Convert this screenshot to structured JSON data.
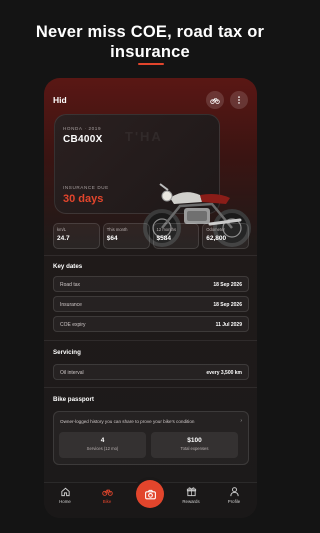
{
  "headline": {
    "line1": "Never miss COE, road tax or",
    "line2": "insurance"
  },
  "app": {
    "user_name": "Hid",
    "hero": {
      "make": "HONDA",
      "year": "2019",
      "model": "CB400X",
      "watermark": "T'HA",
      "insurance_label": "INSURANCE DUE",
      "insurance_value": "30 days"
    },
    "stats": [
      {
        "label": "km/L",
        "value": "24.7"
      },
      {
        "label": "This month",
        "value": "$64"
      },
      {
        "label": "12 months",
        "value": "$584"
      },
      {
        "label": "Odometer",
        "value": "62,800"
      }
    ],
    "key_dates": {
      "title": "Key dates",
      "items": [
        {
          "label": "Road tax",
          "value": "18 Sep 2026"
        },
        {
          "label": "Insurance",
          "value": "18 Sep 2026"
        },
        {
          "label": "COE expiry",
          "value": "11 Jul 2029"
        }
      ]
    },
    "servicing": {
      "title": "Servicing",
      "item": {
        "label": "Oil interval",
        "value": "every 3,500 km"
      }
    },
    "passport": {
      "title": "Bike passport",
      "description": "Owner-logged history you can share to prove your bike's condition",
      "chevron": "›",
      "services_value": "4",
      "services_label": "Services (12 mo)",
      "expenses_value": "$100",
      "expenses_label": "Total expenses"
    },
    "tabs": [
      {
        "label": "Home",
        "icon": "home-icon"
      },
      {
        "label": "Bike",
        "icon": "bike-icon"
      },
      {
        "label": "Rewards",
        "icon": "gift-icon"
      },
      {
        "label": "Profile",
        "icon": "profile-icon"
      }
    ],
    "accent_color": "#e2452c"
  }
}
